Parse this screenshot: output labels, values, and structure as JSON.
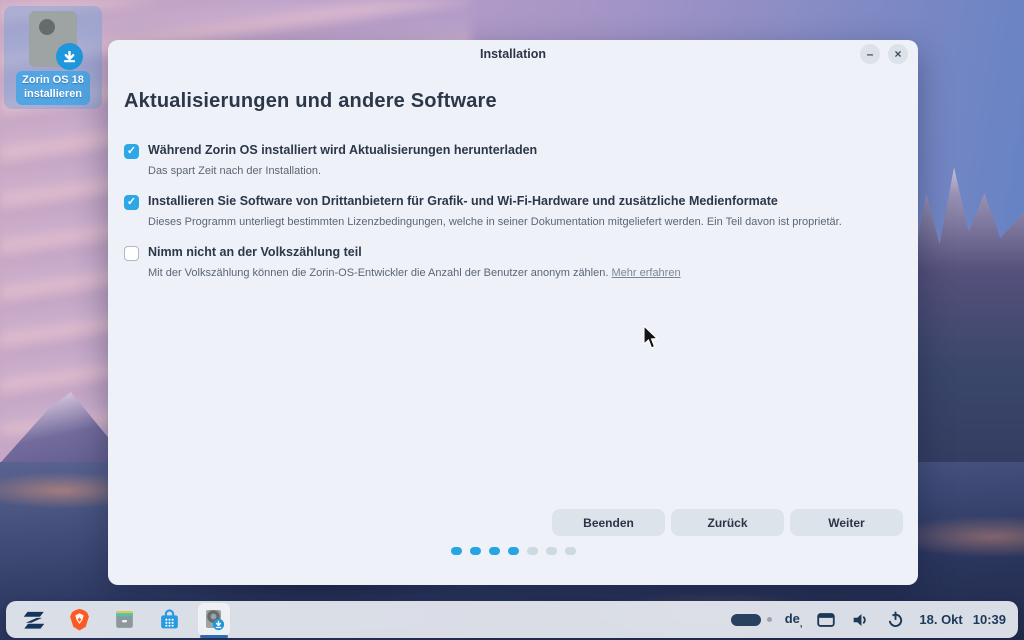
{
  "desktop": {
    "icon": {
      "label_line1": "Zorin OS 18",
      "label_line2": "installieren"
    }
  },
  "installer": {
    "window_title": "Installation",
    "window_controls": {
      "minimize": "–",
      "close": "×"
    },
    "heading": "Aktualisierungen und andere Software",
    "options": [
      {
        "checked": true,
        "label": "Während Zorin OS installiert wird Aktualisierungen herunterladen",
        "description": "Das spart Zeit nach der Installation."
      },
      {
        "checked": true,
        "label": "Installieren Sie Software von Drittanbietern für Grafik- und Wi-Fi-Hardware und zusätzliche Medienformate",
        "description": "Dieses Programm unterliegt bestimmten Lizenzbedingungen, welche in seiner Dokumentation mitgeliefert werden. Ein Teil davon ist proprietär."
      },
      {
        "checked": false,
        "label": "Nimm nicht an der Volkszählung teil",
        "description": "Mit der Volkszählung können die Zorin-OS-Entwickler die Anzahl der Benutzer anonym zählen.",
        "link": "Mehr erfahren"
      }
    ],
    "buttons": {
      "quit": "Beenden",
      "back": "Zurück",
      "next": "Weiter"
    },
    "progress": {
      "total": 7,
      "active": 4
    }
  },
  "taskbar": {
    "apps": [
      "zorin-menu",
      "brave-browser",
      "files",
      "software-store",
      "installer"
    ],
    "keyboard_layout": "de",
    "keyboard_layout_mark": ",",
    "date": "18. Okt",
    "time": "10:39"
  },
  "colors": {
    "accent_blue": "#2ea7e6",
    "progress_active": "#27a5e2",
    "progress_inactive": "#ccd8e2",
    "selection_blue": "#51a5e3",
    "dialog_bg": "#eef1f7",
    "taskbar_text": "#1c3a57",
    "brave_orange": "#fa5a24"
  }
}
